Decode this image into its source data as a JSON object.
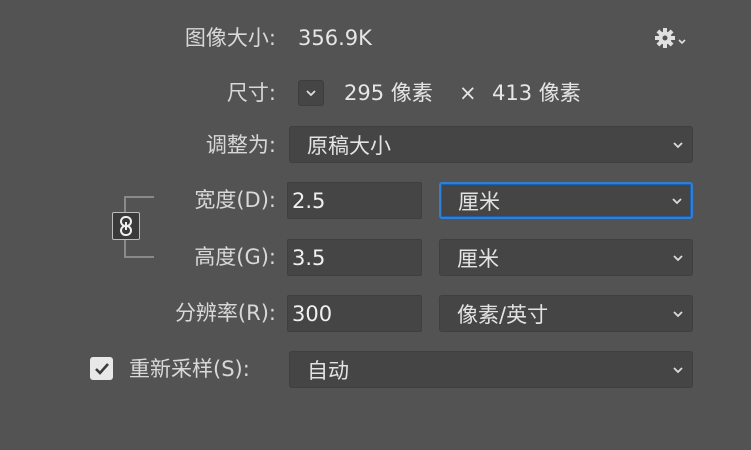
{
  "image_size": {
    "label": "图像大小:",
    "value": "356.9K"
  },
  "settings": {
    "icon": "gear-icon"
  },
  "dimensions": {
    "label": "尺寸:",
    "width": "295 像素",
    "separator": "×",
    "height": "413 像素"
  },
  "fit_to": {
    "label": "调整为:",
    "value": "原稿大小"
  },
  "width": {
    "label": "宽度(D):",
    "value": "2.5",
    "unit": "厘米"
  },
  "height": {
    "label": "高度(G):",
    "value": "3.5",
    "unit": "厘米"
  },
  "resolution": {
    "label": "分辨率(R):",
    "value": "300",
    "unit": "像素/英寸"
  },
  "resample": {
    "label": "重新采样(S):",
    "checked": true,
    "value": "自动"
  },
  "colors": {
    "accent": "#2f7fd6",
    "background": "#535353",
    "field": "#454545"
  }
}
